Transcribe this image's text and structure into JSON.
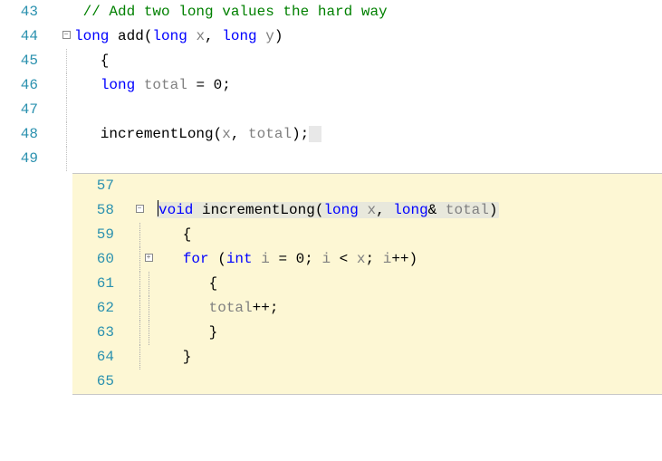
{
  "main": {
    "lines": [
      {
        "num": "43",
        "marker": "green",
        "tokens": [
          {
            "t": " // Add two long values the hard way",
            "c": "cm"
          }
        ]
      },
      {
        "num": "44",
        "marker": "green",
        "outline": "box",
        "tokens": [
          {
            "t": "long",
            "c": "kw"
          },
          {
            "t": " add(",
            "c": "id"
          },
          {
            "t": "long",
            "c": "kw"
          },
          {
            "t": " ",
            "c": "id"
          },
          {
            "t": "x",
            "c": "lcl"
          },
          {
            "t": ", ",
            "c": "id"
          },
          {
            "t": "long",
            "c": "kw"
          },
          {
            "t": " ",
            "c": "id"
          },
          {
            "t": "y",
            "c": "lcl"
          },
          {
            "t": ")",
            "c": "id"
          }
        ]
      },
      {
        "num": "45",
        "marker": "green",
        "outline": "line",
        "tokens": [
          {
            "t": "   {",
            "c": "id"
          }
        ]
      },
      {
        "num": "46",
        "marker": "green",
        "outline": "line",
        "tokens": [
          {
            "t": "   ",
            "c": "id"
          },
          {
            "t": "long",
            "c": "kw"
          },
          {
            "t": " ",
            "c": "id"
          },
          {
            "t": "total",
            "c": "lcl"
          },
          {
            "t": " = 0;",
            "c": "id"
          }
        ]
      },
      {
        "num": "47",
        "marker": "green",
        "outline": "line",
        "tokens": []
      },
      {
        "num": "48",
        "marker": "yellow",
        "outline": "line",
        "tokens": [
          {
            "t": "   incrementLong(",
            "c": "id"
          },
          {
            "t": "x",
            "c": "lcl"
          },
          {
            "t": ", ",
            "c": "id"
          },
          {
            "t": "total",
            "c": "lcl"
          },
          {
            "t": ");",
            "c": "id"
          },
          {
            "t": " ",
            "c": "id",
            "hl": true
          }
        ]
      },
      {
        "num": "49",
        "marker": "yellow",
        "outline": "line",
        "tokens": []
      }
    ]
  },
  "peek": {
    "lines": [
      {
        "num": "57",
        "marker": "",
        "o1": "",
        "o2": "",
        "sig": false,
        "tokens": []
      },
      {
        "num": "58",
        "marker": "blue",
        "o1": "box",
        "o2": "",
        "sig": true,
        "tokens": [
          {
            "t": "void",
            "c": "kw",
            "caret": true
          },
          {
            "t": " incrementLong(",
            "c": "id"
          },
          {
            "t": "long",
            "c": "kw"
          },
          {
            "t": " ",
            "c": "id"
          },
          {
            "t": "x",
            "c": "lcl"
          },
          {
            "t": ", ",
            "c": "id"
          },
          {
            "t": "long",
            "c": "kw"
          },
          {
            "t": "& ",
            "c": "id"
          },
          {
            "t": "total",
            "c": "lcl"
          },
          {
            "t": ")",
            "c": "id"
          }
        ]
      },
      {
        "num": "59",
        "marker": "blue",
        "o1": "line",
        "o2": "",
        "sig": false,
        "tokens": [
          {
            "t": "   {",
            "c": "id"
          }
        ]
      },
      {
        "num": "60",
        "marker": "blue",
        "o1": "line",
        "o2": "box",
        "sig": false,
        "tokens": [
          {
            "t": "   ",
            "c": "id"
          },
          {
            "t": "for",
            "c": "kw"
          },
          {
            "t": " (",
            "c": "id"
          },
          {
            "t": "int",
            "c": "kw"
          },
          {
            "t": " ",
            "c": "id"
          },
          {
            "t": "i",
            "c": "lcl"
          },
          {
            "t": " = 0; ",
            "c": "id"
          },
          {
            "t": "i",
            "c": "lcl"
          },
          {
            "t": " < ",
            "c": "id"
          },
          {
            "t": "x",
            "c": "lcl"
          },
          {
            "t": "; ",
            "c": "id"
          },
          {
            "t": "i",
            "c": "lcl"
          },
          {
            "t": "++)",
            "c": "id"
          }
        ]
      },
      {
        "num": "61",
        "marker": "blue",
        "o1": "line",
        "o2": "line",
        "sig": false,
        "tokens": [
          {
            "t": "      {",
            "c": "id"
          }
        ]
      },
      {
        "num": "62",
        "marker": "blue",
        "o1": "line",
        "o2": "line",
        "sig": false,
        "tokens": [
          {
            "t": "      ",
            "c": "id"
          },
          {
            "t": "total",
            "c": "lcl"
          },
          {
            "t": "++;",
            "c": "id"
          }
        ]
      },
      {
        "num": "63",
        "marker": "blue",
        "o1": "line",
        "o2": "line",
        "sig": false,
        "tokens": [
          {
            "t": "      }",
            "c": "id"
          }
        ]
      },
      {
        "num": "64",
        "marker": "blue",
        "o1": "line",
        "o2": "",
        "sig": false,
        "tokens": [
          {
            "t": "   }",
            "c": "id"
          }
        ]
      },
      {
        "num": "65",
        "marker": "",
        "o1": "",
        "o2": "",
        "sig": false,
        "tokens": []
      }
    ]
  }
}
